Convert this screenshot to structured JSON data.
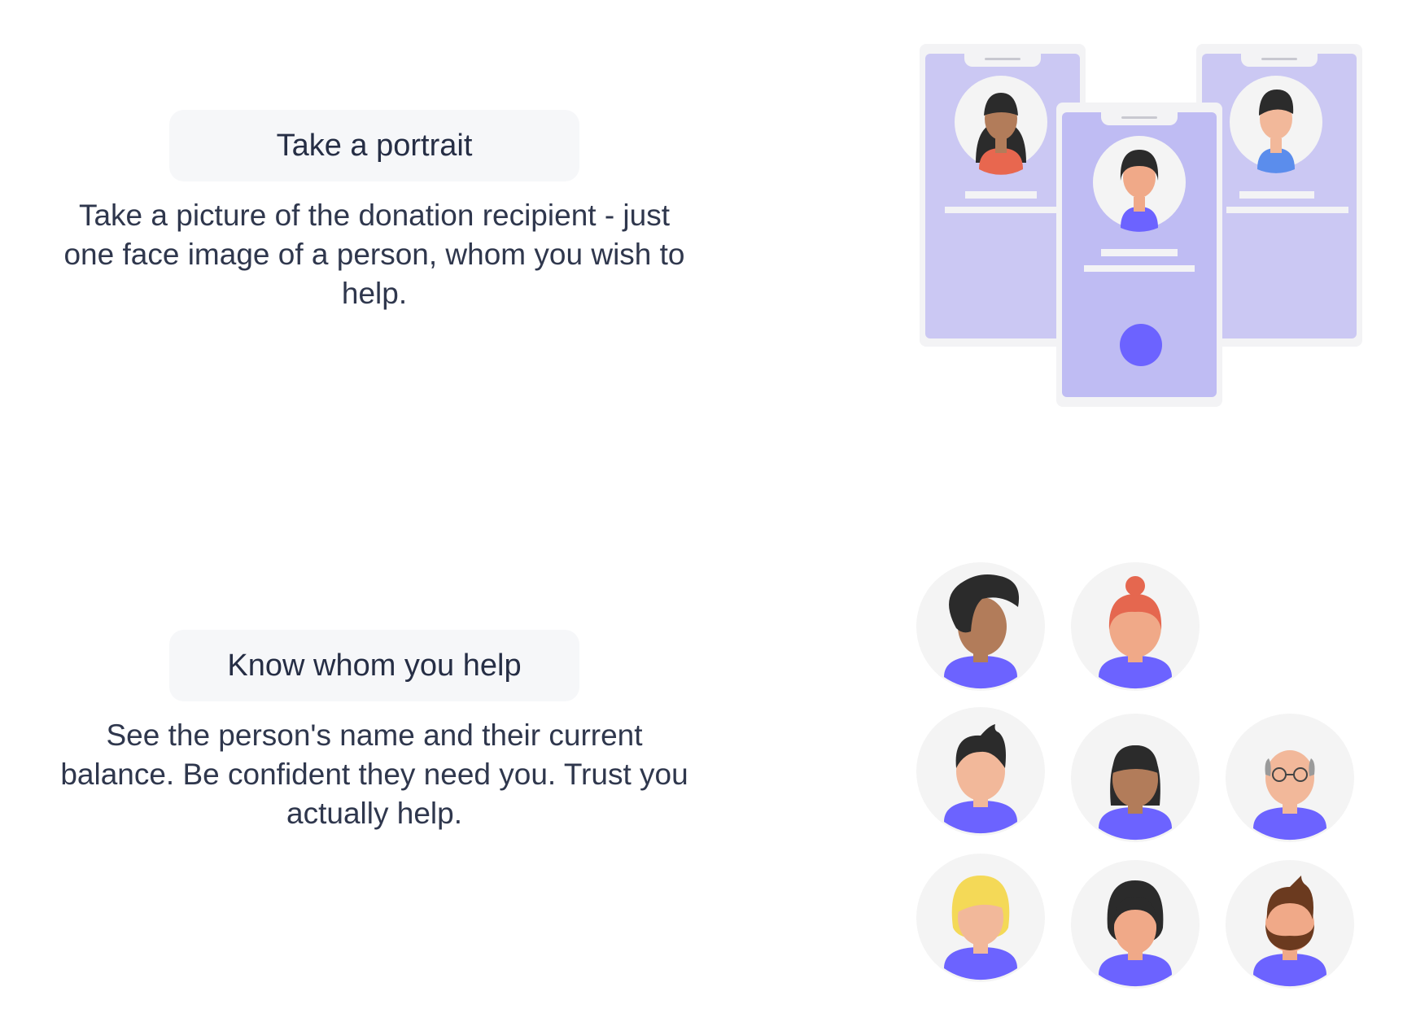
{
  "features": [
    {
      "title": "Take a portrait",
      "description": "Take a picture of the donation recipient - just one face image of a person, whom you wish to help."
    },
    {
      "title": "Know whom you help",
      "description": "See the person's name and their current balance. Be confident they need you. Trust you actually help."
    }
  ],
  "colors": {
    "title_text": "#262e45",
    "body_text": "#2f374d",
    "pill_bg": "#f6f7f9",
    "phone_screen": "#c9c6f3",
    "accent": "#6c63ff"
  }
}
